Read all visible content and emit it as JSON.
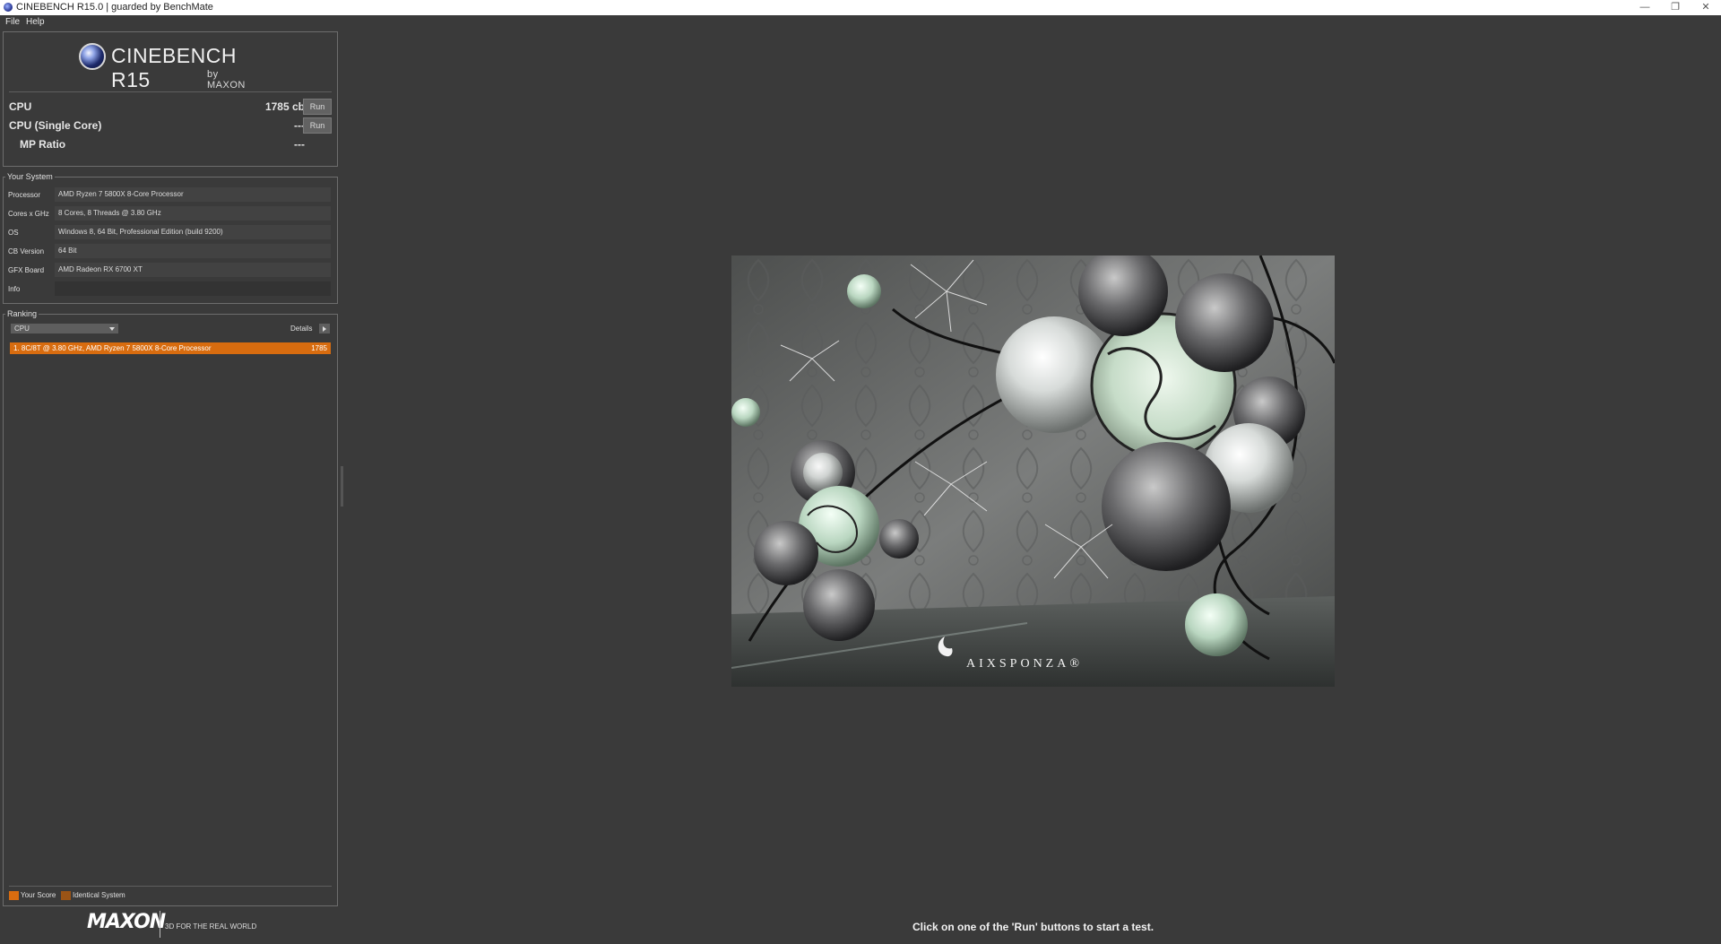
{
  "window": {
    "title": "CINEBENCH R15.0 | guarded by BenchMate",
    "minimize_icon": "minimize-icon",
    "maximize_icon": "restore-icon",
    "close_icon": "close-icon"
  },
  "menu": {
    "file": "File",
    "help": "Help"
  },
  "logo": {
    "name": "CINEBENCH R15",
    "by": "by MAXON"
  },
  "scores": [
    {
      "label": "CPU",
      "value": "1785 cb",
      "button": "Run"
    },
    {
      "label": "CPU (Single Core)",
      "value": "---",
      "button": "Run"
    },
    {
      "label": "MP Ratio",
      "value": "---"
    }
  ],
  "system": {
    "title": "Your System",
    "rows": [
      {
        "key": "Processor",
        "value": "AMD Ryzen 7 5800X 8-Core Processor"
      },
      {
        "key": "Cores x GHz",
        "value": "8 Cores, 8 Threads @ 3.80 GHz"
      },
      {
        "key": "OS",
        "value": "Windows 8, 64 Bit, Professional Edition (build 9200)"
      },
      {
        "key": "CB Version",
        "value": "64 Bit"
      },
      {
        "key": "GFX Board",
        "value": "AMD Radeon RX 6700 XT"
      },
      {
        "key": "Info",
        "value": ""
      }
    ]
  },
  "ranking": {
    "title": "Ranking",
    "selected": "CPU",
    "details": "Details",
    "items": [
      {
        "text": "1. 8C/8T @ 3.80 GHz, AMD Ryzen 7 5800X 8-Core Processor",
        "score": "1785"
      }
    ],
    "legend": {
      "your_score": "Your Score",
      "identical": "Identical System"
    },
    "colors": {
      "your_score": "#d86c0f",
      "identical": "#9a5416"
    }
  },
  "footer": {
    "brand": "MAXON",
    "tagline": "3D FOR THE REAL WORLD"
  },
  "render": {
    "watermark": "AIXSPONZA®"
  },
  "status": "Click on one of the 'Run' buttons to start a test."
}
